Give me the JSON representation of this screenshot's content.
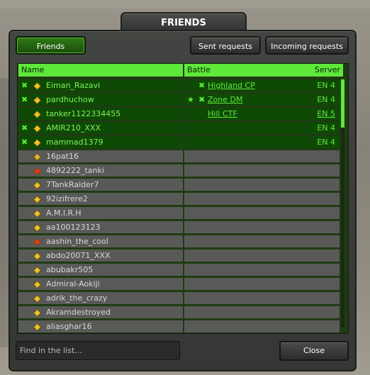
{
  "window": {
    "title": "FRIENDS"
  },
  "tabs": [
    {
      "label": "Friends",
      "active": true
    },
    {
      "label": "Sent requests",
      "active": false
    },
    {
      "label": "Incoming requests",
      "active": false
    }
  ],
  "table": {
    "headers": {
      "name": "Name",
      "battle": "Battle",
      "server": "Server"
    },
    "rows": [
      {
        "name": "Eiman_Razavi",
        "online": true,
        "in_battle": true,
        "rank_icon": "rank-insignia-icon",
        "battle": "Highland CP",
        "battle_icon": "crossed-swords-icon",
        "server": "EN 4"
      },
      {
        "name": "pardhuchow",
        "online": true,
        "in_battle": true,
        "rank_icon": "rank-insignia-icon",
        "battle": "Zone DM",
        "battle_icon": "star-crossed-swords-icon",
        "server": "EN 4"
      },
      {
        "name": "tanker1122334455",
        "online": true,
        "in_battle": false,
        "rank_icon": "rank-insignia-icon",
        "battle": "Hill CTF",
        "battle_icon": "",
        "server": "EN 5"
      },
      {
        "name": "AMIR210_XXX",
        "online": true,
        "in_battle": true,
        "rank_icon": "rank-insignia-icon",
        "battle": "",
        "server": "EN 4"
      },
      {
        "name": "mammad1379",
        "online": true,
        "in_battle": true,
        "rank_icon": "rank-insignia-icon",
        "battle": "",
        "server": "EN 4"
      },
      {
        "name": "16pat16",
        "online": false,
        "rank_icon": "rank-insignia-icon"
      },
      {
        "name": "4892222_tanki",
        "online": false,
        "rank_icon": "rank-insignia-icon"
      },
      {
        "name": "7TankRaider7",
        "online": false,
        "rank_icon": "rank-insignia-icon"
      },
      {
        "name": "92izifrere2",
        "online": false,
        "rank_icon": "rank-insignia-icon"
      },
      {
        "name": "A.M.I.R.H",
        "online": false,
        "rank_icon": "rank-insignia-icon"
      },
      {
        "name": "aa100123123",
        "online": false,
        "rank_icon": "rank-insignia-icon"
      },
      {
        "name": "aashin_the_cool",
        "online": false,
        "rank_icon": "rank-insignia-icon"
      },
      {
        "name": "abdo20071_XXX",
        "online": false,
        "rank_icon": "rank-insignia-icon"
      },
      {
        "name": "abubakr505",
        "online": false,
        "rank_icon": "rank-insignia-icon"
      },
      {
        "name": "Admiral-Aokiji",
        "online": false,
        "rank_icon": "rank-insignia-icon"
      },
      {
        "name": "adrik_the_crazy",
        "online": false,
        "rank_icon": "rank-insignia-icon"
      },
      {
        "name": "Akramdestroyed",
        "online": false,
        "rank_icon": "rank-insignia-icon"
      },
      {
        "name": "aliasghar16",
        "online": false,
        "rank_icon": "rank-insignia-icon"
      }
    ]
  },
  "search": {
    "placeholder": "Find in the list..."
  },
  "close_button": {
    "label": "Close"
  },
  "colors": {
    "accent": "#5ee83a",
    "online_row": "#0e4a06",
    "offline_row": "#595a58"
  }
}
